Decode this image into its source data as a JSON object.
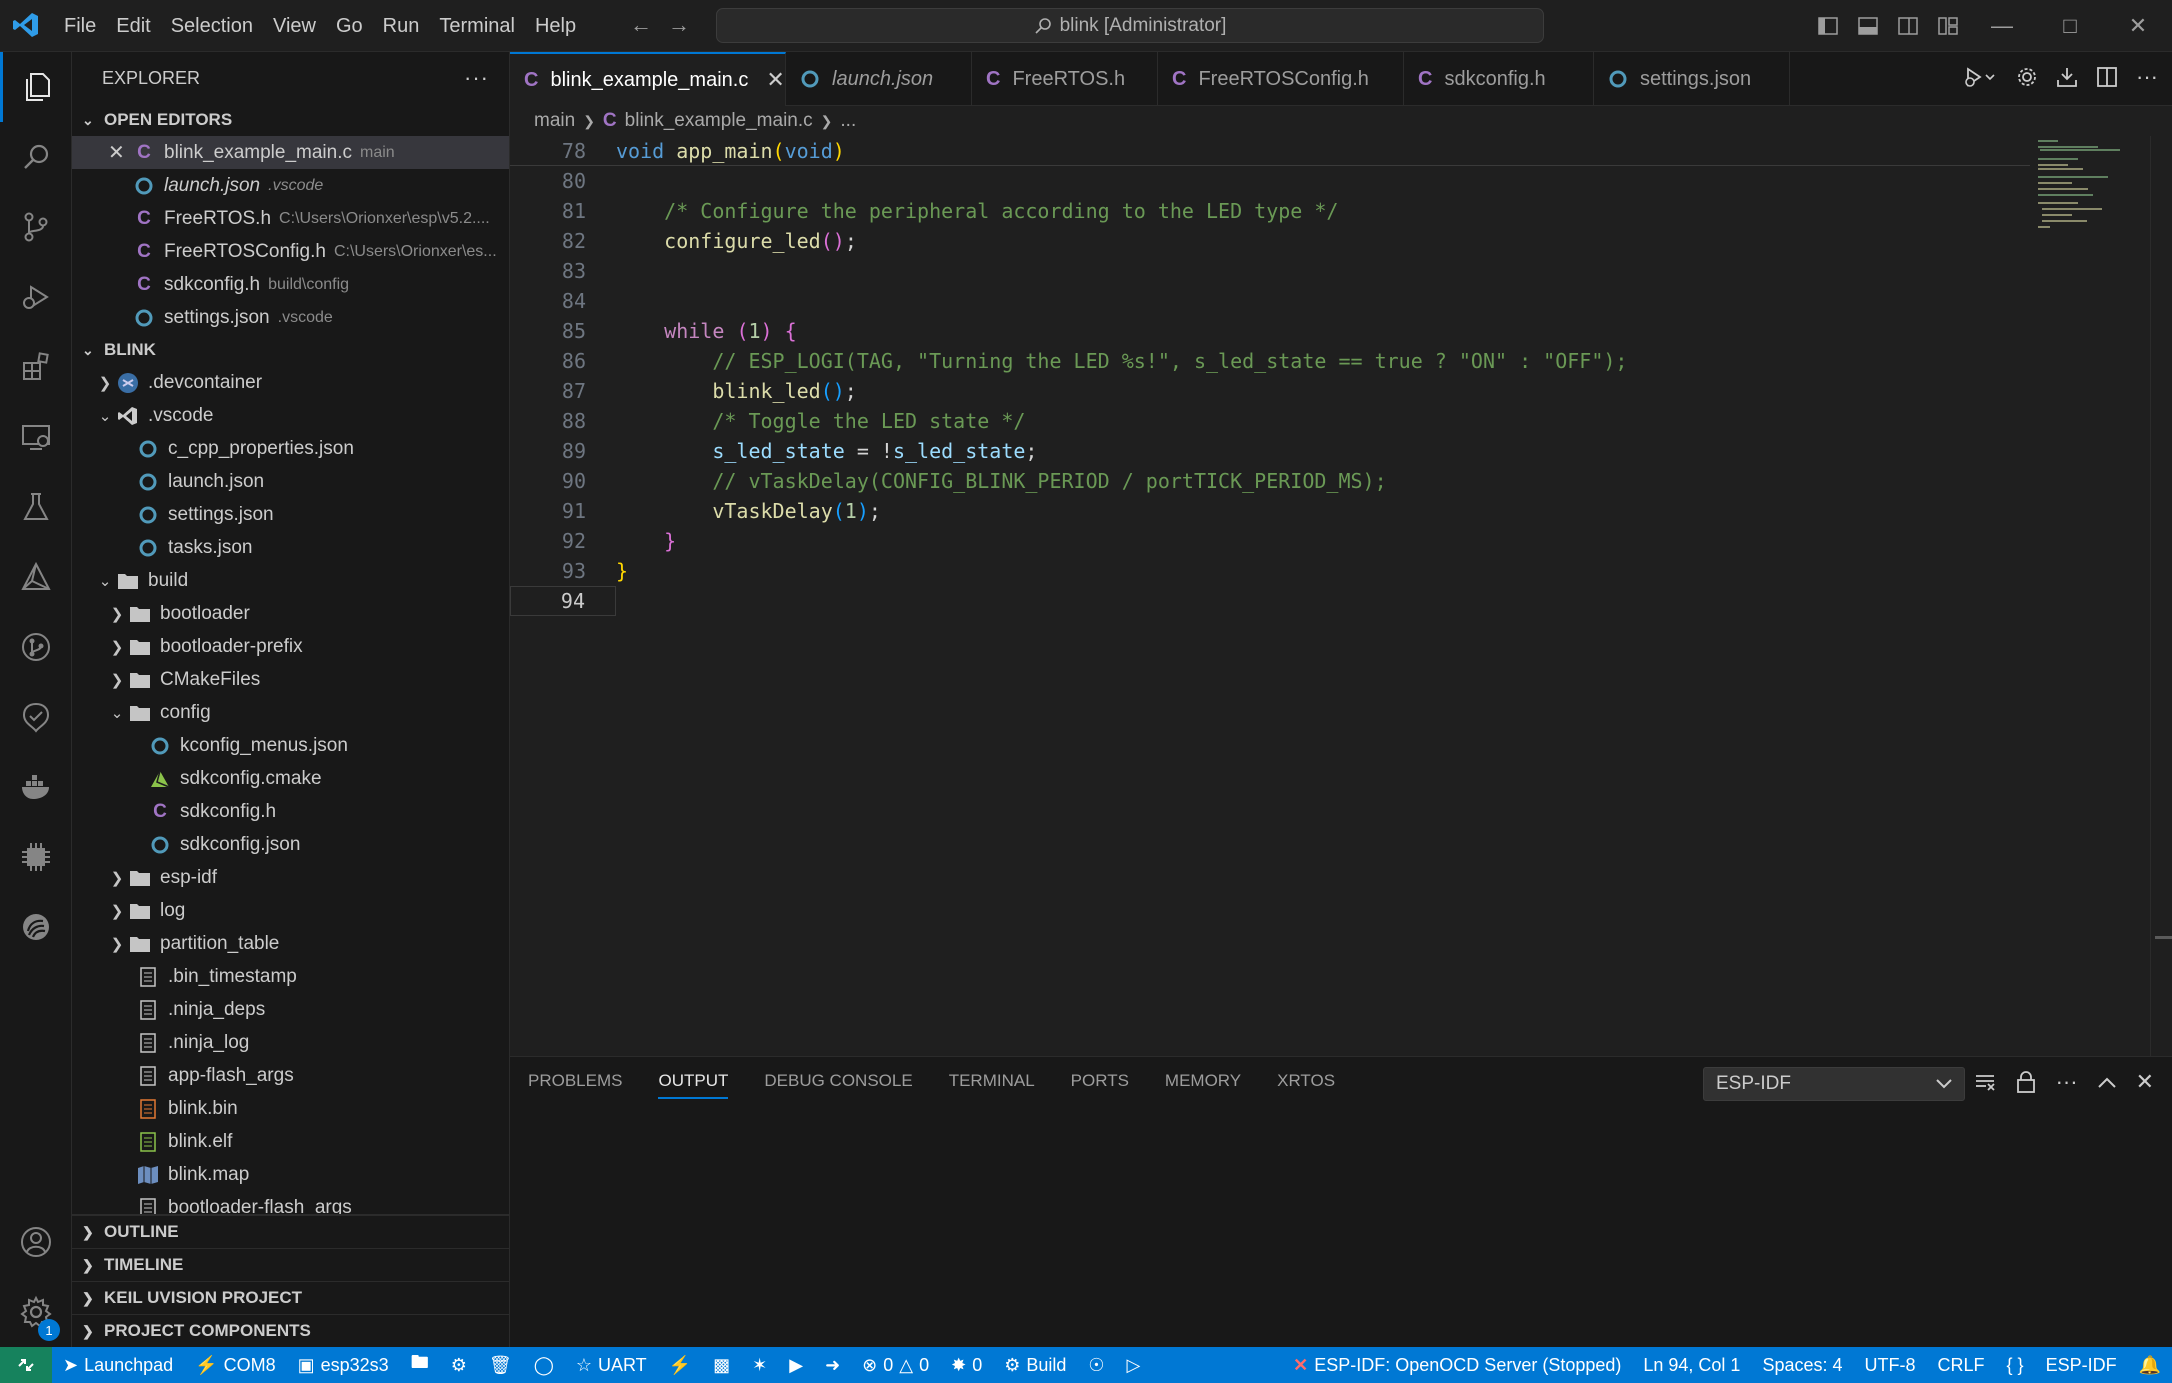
{
  "window": {
    "command_center": "blink [Administrator]",
    "menu": [
      "File",
      "Edit",
      "Selection",
      "View",
      "Go",
      "Run",
      "Terminal",
      "Help"
    ]
  },
  "activity_bar": {
    "items": [
      "explorer-icon",
      "search-icon",
      "source-control-icon",
      "run-debug-icon",
      "extensions-icon",
      "remote-explorer-icon",
      "testing-icon",
      "cmake-icon",
      "git-graph-icon",
      "testing-check-icon",
      "docker-icon",
      "chip-icon",
      "espressif-icon"
    ],
    "settings_badge": "1"
  },
  "sidebar": {
    "title": "EXPLORER",
    "open_editors_label": "OPEN EDITORS",
    "open_editors": [
      {
        "name": "blink_example_main.c",
        "desc": "main",
        "type": "c"
      },
      {
        "name": "launch.json",
        "desc": ".vscode",
        "type": "json"
      },
      {
        "name": "FreeRTOS.h",
        "desc": "C:\\Users\\Orionxer\\esp\\v5.2....",
        "type": "c"
      },
      {
        "name": "FreeRTOSConfig.h",
        "desc": "C:\\Users\\Orionxer\\es...",
        "type": "c"
      },
      {
        "name": "sdkconfig.h",
        "desc": "build\\config",
        "type": "c"
      },
      {
        "name": "settings.json",
        "desc": ".vscode",
        "type": "json"
      }
    ],
    "project_label": "BLINK",
    "tree": [
      {
        "name": ".devcontainer",
        "icon": "devcontainer"
      },
      {
        "name": ".vscode",
        "icon": "vscode"
      },
      {
        "name": "c_cpp_properties.json"
      },
      {
        "name": "launch.json"
      },
      {
        "name": "settings.json"
      },
      {
        "name": "tasks.json"
      },
      {
        "name": "build"
      },
      {
        "name": "bootloader"
      },
      {
        "name": "bootloader-prefix"
      },
      {
        "name": "CMakeFiles"
      },
      {
        "name": "config"
      },
      {
        "name": "kconfig_menus.json"
      },
      {
        "name": "sdkconfig.cmake"
      },
      {
        "name": "sdkconfig.h"
      },
      {
        "name": "sdkconfig.json"
      },
      {
        "name": "esp-idf"
      },
      {
        "name": "log"
      },
      {
        "name": "partition_table"
      },
      {
        "name": ".bin_timestamp"
      },
      {
        "name": ".ninja_deps"
      },
      {
        "name": ".ninja_log"
      },
      {
        "name": "app-flash_args"
      },
      {
        "name": "blink.bin"
      },
      {
        "name": "blink.elf"
      },
      {
        "name": "blink.map"
      },
      {
        "name": "bootloader-flash_args"
      }
    ],
    "bottom_sections": [
      "OUTLINE",
      "TIMELINE",
      "KEIL UVISION PROJECT",
      "PROJECT COMPONENTS"
    ]
  },
  "editor": {
    "tabs": [
      {
        "label": "blink_example_main.c",
        "type": "c",
        "active": true
      },
      {
        "label": "launch.json",
        "type": "json",
        "italic": true
      },
      {
        "label": "FreeRTOS.h",
        "type": "c"
      },
      {
        "label": "FreeRTOSConfig.h",
        "type": "c"
      },
      {
        "label": "sdkconfig.h",
        "type": "c"
      },
      {
        "label": "settings.json",
        "type": "json"
      }
    ],
    "breadcrumb": {
      "folder": "main",
      "file": "blink_example_main.c",
      "more": "..."
    },
    "lines": [
      {
        "n": "78",
        "text": "void app_main(void)"
      },
      {
        "n": "80",
        "text": ""
      },
      {
        "n": "81",
        "text": "    /* Configure the peripheral according to the LED type */"
      },
      {
        "n": "82",
        "text": "    configure_led();"
      },
      {
        "n": "83",
        "text": ""
      },
      {
        "n": "84",
        "text": ""
      },
      {
        "n": "85",
        "text": "    while (1) {"
      },
      {
        "n": "86",
        "text": "        // ESP_LOGI(TAG, \"Turning the LED %s!\", s_led_state == true ? \"ON\" : \"OFF\");"
      },
      {
        "n": "87",
        "text": "        blink_led();"
      },
      {
        "n": "88",
        "text": "        /* Toggle the LED state */"
      },
      {
        "n": "89",
        "text": "        s_led_state = !s_led_state;"
      },
      {
        "n": "90",
        "text": "        // vTaskDelay(CONFIG_BLINK_PERIOD / portTICK_PERIOD_MS);"
      },
      {
        "n": "91",
        "text": "        vTaskDelay(1);"
      },
      {
        "n": "92",
        "text": "    }"
      },
      {
        "n": "93",
        "text": "}"
      },
      {
        "n": "94",
        "text": ""
      }
    ],
    "current_line": "94"
  },
  "panel": {
    "tabs": [
      "PROBLEMS",
      "OUTPUT",
      "DEBUG CONSOLE",
      "TERMINAL",
      "PORTS",
      "MEMORY",
      "XRTOS"
    ],
    "active_tab": "OUTPUT",
    "output_channel": "ESP-IDF"
  },
  "statusbar": {
    "launchpad": "Launchpad",
    "port": "COM8",
    "target": "esp32s3",
    "uart": "UART",
    "errors": "0",
    "warnings": "0",
    "ports_count": "0",
    "build": "Build",
    "openocd": "ESP-IDF: OpenOCD Server (Stopped)",
    "position": "Ln 94, Col 1",
    "spaces": "Spaces: 4",
    "encoding": "UTF-8",
    "eol": "CRLF",
    "braces": "{ }",
    "language": "ESP-IDF"
  },
  "colors": {
    "accent": "#0078d4",
    "remote": "#16825d",
    "c_icon": "#a074c4",
    "json_icon": "#519aba"
  }
}
